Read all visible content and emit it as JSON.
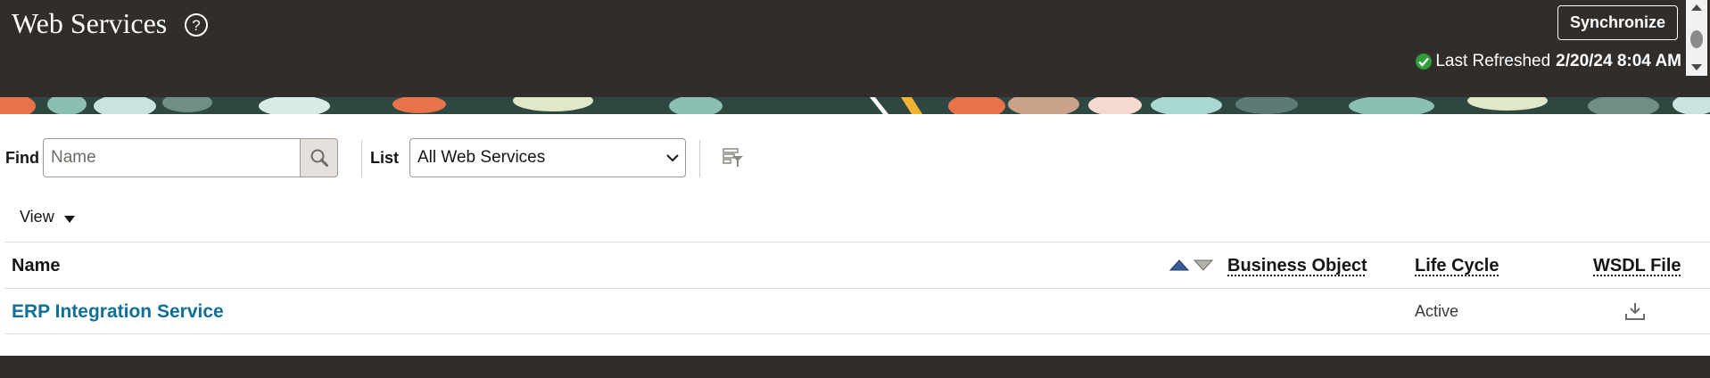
{
  "header": {
    "title": "Web Services",
    "help_icon": "help-circle-icon",
    "synchronize_label": "Synchronize",
    "last_refreshed_label": "Last Refreshed",
    "last_refreshed_value": "2/20/24 8:04 AM",
    "status_icon": "check-circle-icon",
    "status_color": "#2c9e3a"
  },
  "toolbar": {
    "find_label": "Find",
    "find_placeholder": "Name",
    "find_value": "",
    "search_icon": "magnifier-icon",
    "list_label": "List",
    "list_selected": "All Web Services",
    "detach_icon": "detach-table-icon"
  },
  "view_menu": {
    "label": "View"
  },
  "table": {
    "columns": [
      "Name",
      "Business Object",
      "Life Cycle",
      "WSDL File"
    ],
    "rows": [
      {
        "name": "ERP Integration Service",
        "business_object": "",
        "life_cycle": "Active",
        "wsdl_icon": "download-icon"
      }
    ]
  },
  "colors": {
    "header_bg": "#312d2a",
    "link": "#0e6f99",
    "sort_active": "#3a5d96"
  }
}
